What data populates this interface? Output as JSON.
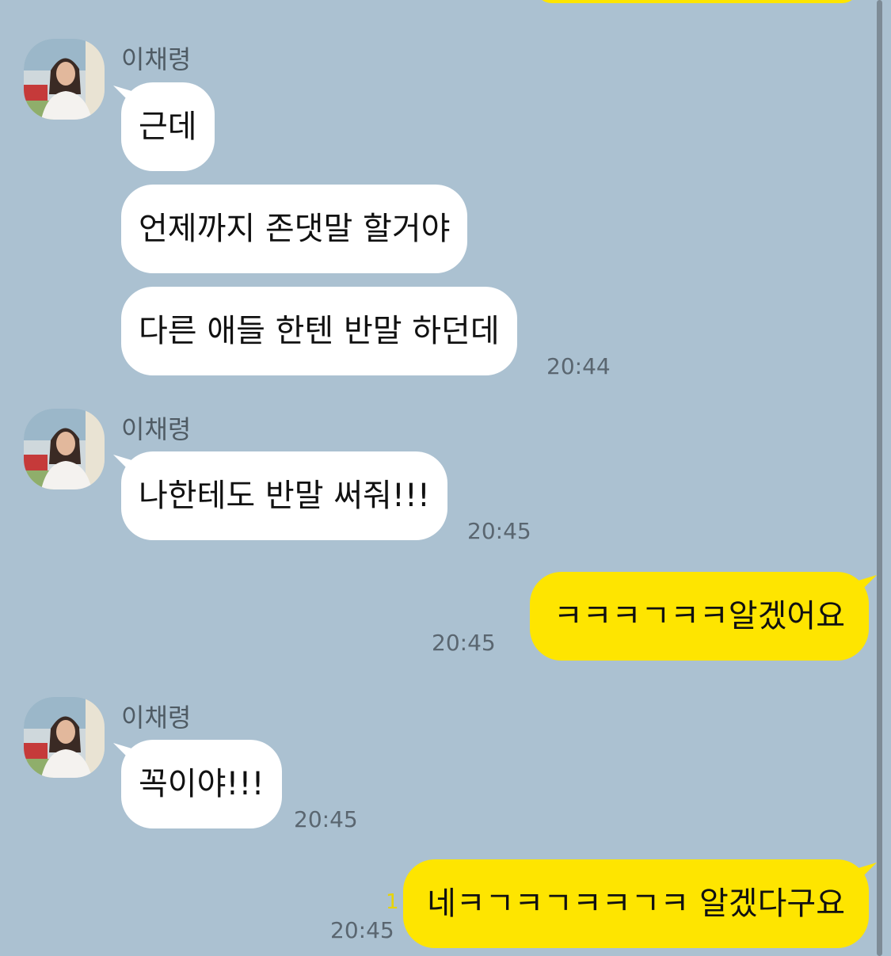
{
  "chat": {
    "messages": [
      {
        "sender": "이채령",
        "bubbles": [
          "근데",
          "언제까지 존댓말 할거야",
          "다른 애들 한텐 반말 하던데"
        ],
        "time": "20:44"
      },
      {
        "sender": "이채령",
        "bubbles": [
          "나한테도 반말 써줘!!!"
        ],
        "time": "20:45"
      },
      {
        "outgoing": true,
        "bubbles": [
          "ㅋㅋㅋㄱㅋㅋ알겠어요"
        ],
        "time": "20:45"
      },
      {
        "sender": "이채령",
        "bubbles": [
          "꼭이야!!!"
        ],
        "time": "20:45"
      },
      {
        "outgoing": true,
        "bubbles": [
          "네ㅋㄱㅋㄱㅋㅋㄱㅋ 알겠다구요"
        ],
        "time": "20:45",
        "unread_count": "1"
      }
    ]
  },
  "colors": {
    "background": "#abc1d1",
    "incoming_bubble": "#ffffff",
    "outgoing_bubble": "#fee500"
  }
}
